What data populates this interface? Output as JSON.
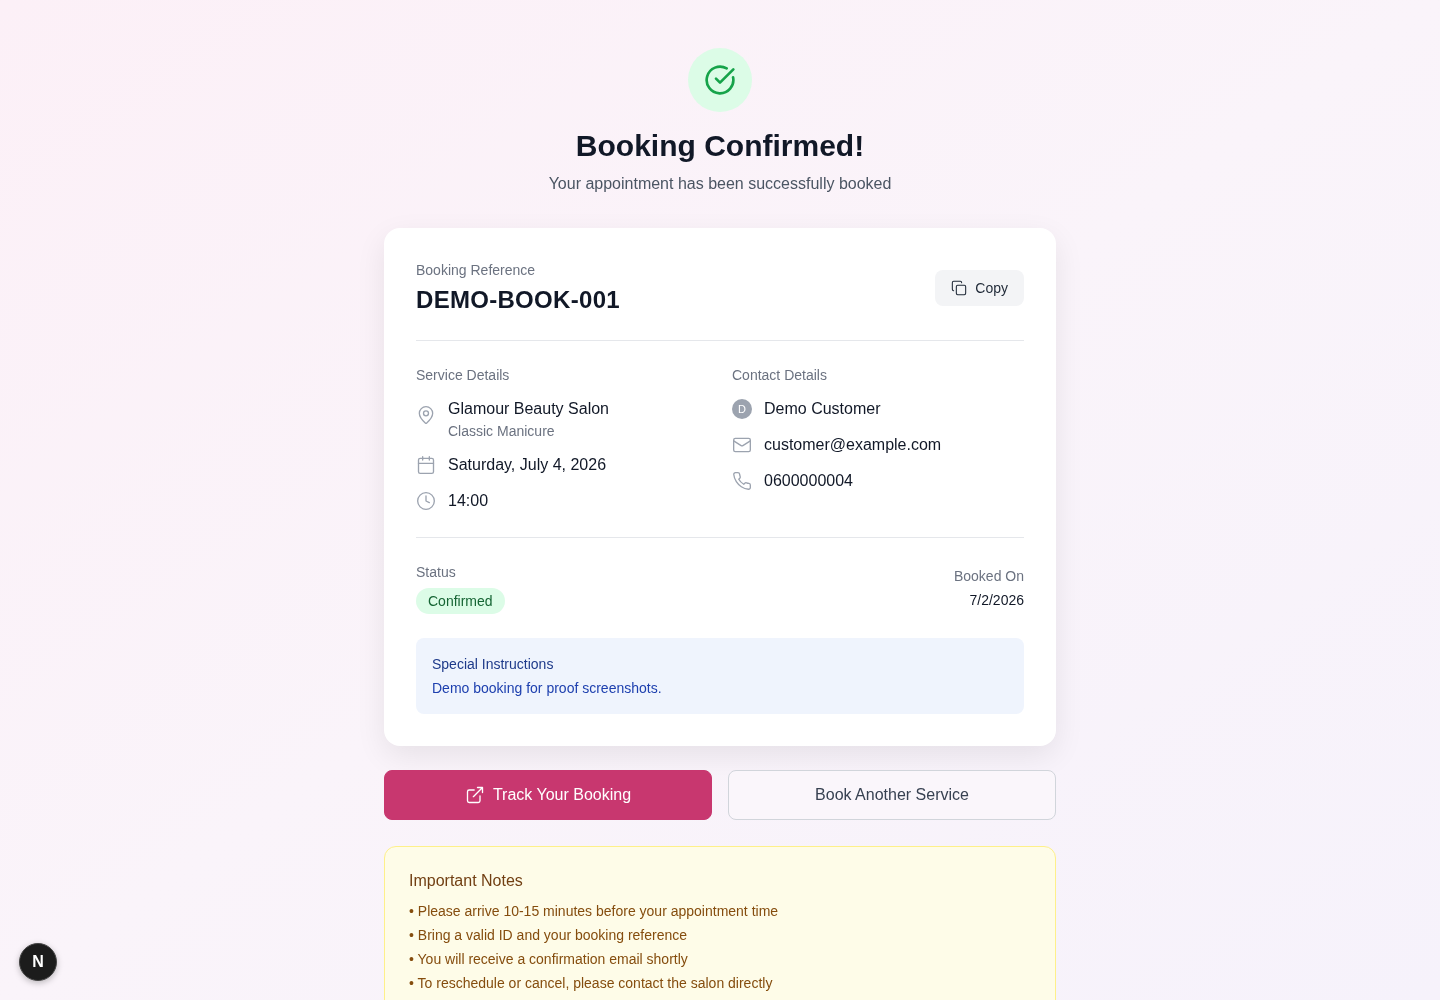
{
  "header": {
    "title": "Booking Confirmed!",
    "subtitle": "Your appointment has been successfully booked"
  },
  "booking_card": {
    "reference": {
      "label": "Booking Reference",
      "value": "DEMO-BOOK-001",
      "copy_button": "Copy"
    },
    "service_details": {
      "heading": "Service Details",
      "salon": "Glamour Beauty Salon",
      "service": "Classic Manicure",
      "date": "Saturday, July 4, 2026",
      "time": "14:00"
    },
    "contact_details": {
      "heading": "Contact Details",
      "avatar_initial": "D",
      "name": "Demo Customer",
      "email": "customer@example.com",
      "phone": "0600000004"
    },
    "status": {
      "label": "Status",
      "value": "Confirmed",
      "kind": "confirmed"
    },
    "booked_on": {
      "label": "Booked On",
      "value": "7/2/2026"
    },
    "special_instructions": {
      "title": "Special Instructions",
      "text": "Demo booking for proof screenshots."
    }
  },
  "actions": [
    {
      "label": "Track Your Booking",
      "kind": "primary"
    },
    {
      "label": "Book Another Service",
      "kind": "secondary"
    }
  ],
  "important_notes": {
    "title": "Important Notes",
    "items": [
      "• Please arrive 10-15 minutes before your appointment time",
      "• Bring a valid ID and your booking reference",
      "• You will receive a confirmation email shortly",
      "• To reschedule or cancel, please contact the salon directly"
    ]
  },
  "dev_indicator": {
    "label": "N"
  }
}
